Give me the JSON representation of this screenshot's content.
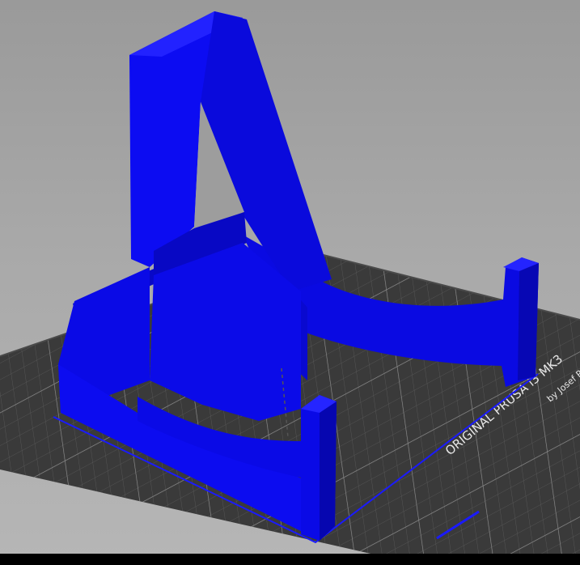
{
  "bed": {
    "printer_name": "ORIGINAL PRUSA i3  MK3",
    "maker_text": "by Josef P"
  },
  "colors": {
    "model_face_light": "#1010ff",
    "model_face_mid": "#0a0ae0",
    "model_face_dark": "#0606b8",
    "bed_surface": "#3a3a3a",
    "bed_grid": "#6a6a6a",
    "background": "#a7a7a7"
  },
  "icons": [
    "printer-bed-grid",
    "stand-model"
  ]
}
